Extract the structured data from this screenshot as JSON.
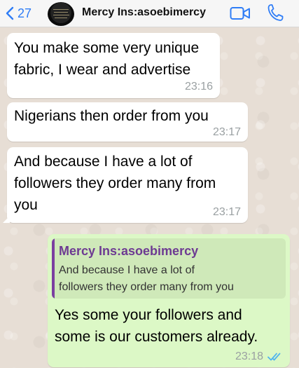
{
  "header": {
    "back_count": "27",
    "contact_name": "Mercy Ins:asoebimercy",
    "colors": {
      "accent": "#2f7df6",
      "header_bg": "#f6f6f6"
    }
  },
  "messages": [
    {
      "direction": "incoming",
      "lines": [
        "You make some very unique",
        "fabric, I wear and advertise"
      ],
      "time": "23:16"
    },
    {
      "direction": "incoming",
      "lines": [
        "Nigerians then order from you"
      ],
      "time": "23:17"
    },
    {
      "direction": "incoming",
      "lines": [
        "And because I have a lot of",
        "followers they order many from",
        "you"
      ],
      "time": "23:17"
    },
    {
      "direction": "outgoing",
      "quote": {
        "author": "Mercy Ins:asoebimercy",
        "lines": [
          "And because I have a lot of",
          "followers they order many from you"
        ]
      },
      "lines": [
        "Yes some your followers and",
        "some is our customers already."
      ],
      "time": "23:18",
      "status": "read-double-check-icon"
    }
  ],
  "colors": {
    "incoming_bubble": "#ffffff",
    "outgoing_bubble": "#dcf8c6",
    "quote_bar": "#7b3fa0",
    "read_check": "#4fb4ee"
  }
}
